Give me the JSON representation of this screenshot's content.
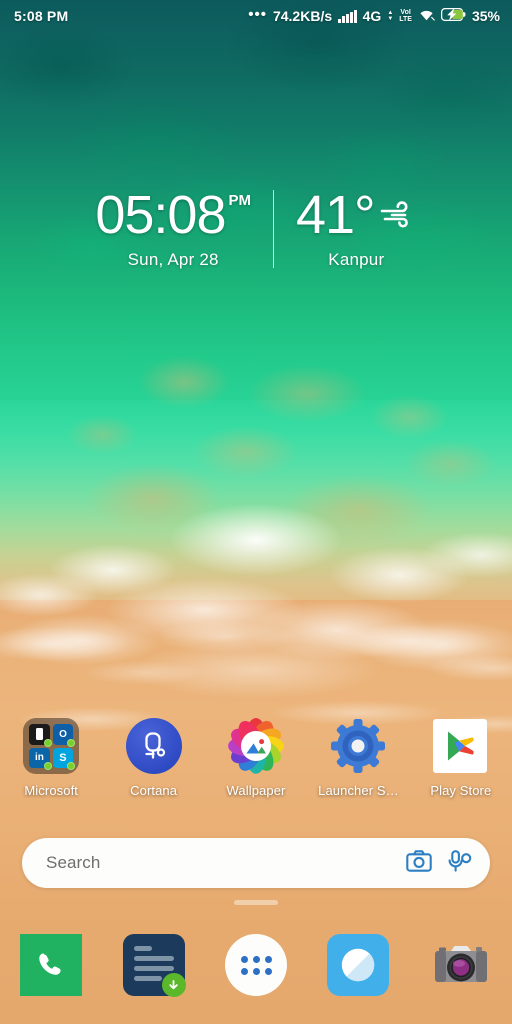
{
  "status_bar": {
    "time": "5:08 PM",
    "notification_dots": "•••",
    "network_speed": "74.2KB/s",
    "signal_icon": "signal-bars-icon",
    "network_type": "4G",
    "data_arrows_icon": "data-transfer-arrows-icon",
    "volte_line1": "VoI",
    "volte_line2": "LTE",
    "wifi_icon": "wifi-icon",
    "battery_icon": "battery-charging-icon",
    "battery_percent": "35%",
    "battery_fill_color": "#8cc63f"
  },
  "clock_widget": {
    "time": "05:08",
    "ampm": "PM",
    "date": "Sun, Apr 28",
    "temperature": "41°",
    "weather_icon": "wind-icon",
    "city": "Kanpur"
  },
  "app_row": [
    {
      "label": "Microsoft",
      "icon": "microsoft-folder-icon",
      "type": "folder",
      "folder_apps": [
        {
          "name": "phone-app-icon",
          "glyph": "",
          "badge": true
        },
        {
          "name": "outlook-icon",
          "glyph": "O",
          "badge": true
        },
        {
          "name": "linkedin-icon",
          "glyph": "in",
          "badge": true
        },
        {
          "name": "skype-icon",
          "glyph": "S",
          "badge": true
        }
      ]
    },
    {
      "label": "Cortana",
      "icon": "cortana-icon",
      "type": "app"
    },
    {
      "label": "Wallpaper",
      "icon": "wallpaper-app-icon",
      "type": "app"
    },
    {
      "label": "Launcher S…",
      "icon": "launcher-settings-icon",
      "type": "app"
    },
    {
      "label": "Play Store",
      "icon": "play-store-icon",
      "type": "app"
    }
  ],
  "search": {
    "placeholder": "Search",
    "value": "",
    "camera_icon": "camera-lens-icon",
    "voice_icon": "voice-search-icon",
    "icon_color": "#2d7fc4"
  },
  "page_indicator": {
    "pages": 1,
    "current": 1
  },
  "dock": [
    {
      "label": "Phone",
      "icon": "phone-icon",
      "color": "#21b261"
    },
    {
      "label": "Notes",
      "icon": "notes-document-icon",
      "color": "#1b3a5c",
      "badge": "download-badge"
    },
    {
      "label": "App Drawer",
      "icon": "app-drawer-icon",
      "color": "#2d6fc4"
    },
    {
      "label": "Browser",
      "icon": "browser-icon",
      "color": "#41b0ea"
    },
    {
      "label": "Camera",
      "icon": "camera-icon",
      "color": "#8c8c8c"
    }
  ],
  "wallpaper": {
    "name": "aerial-beach-wallpaper",
    "deep_water": "#0d5a5c",
    "shallow_water": "#2bd69a",
    "sand": "#eab279",
    "foam": "#ffffff"
  }
}
